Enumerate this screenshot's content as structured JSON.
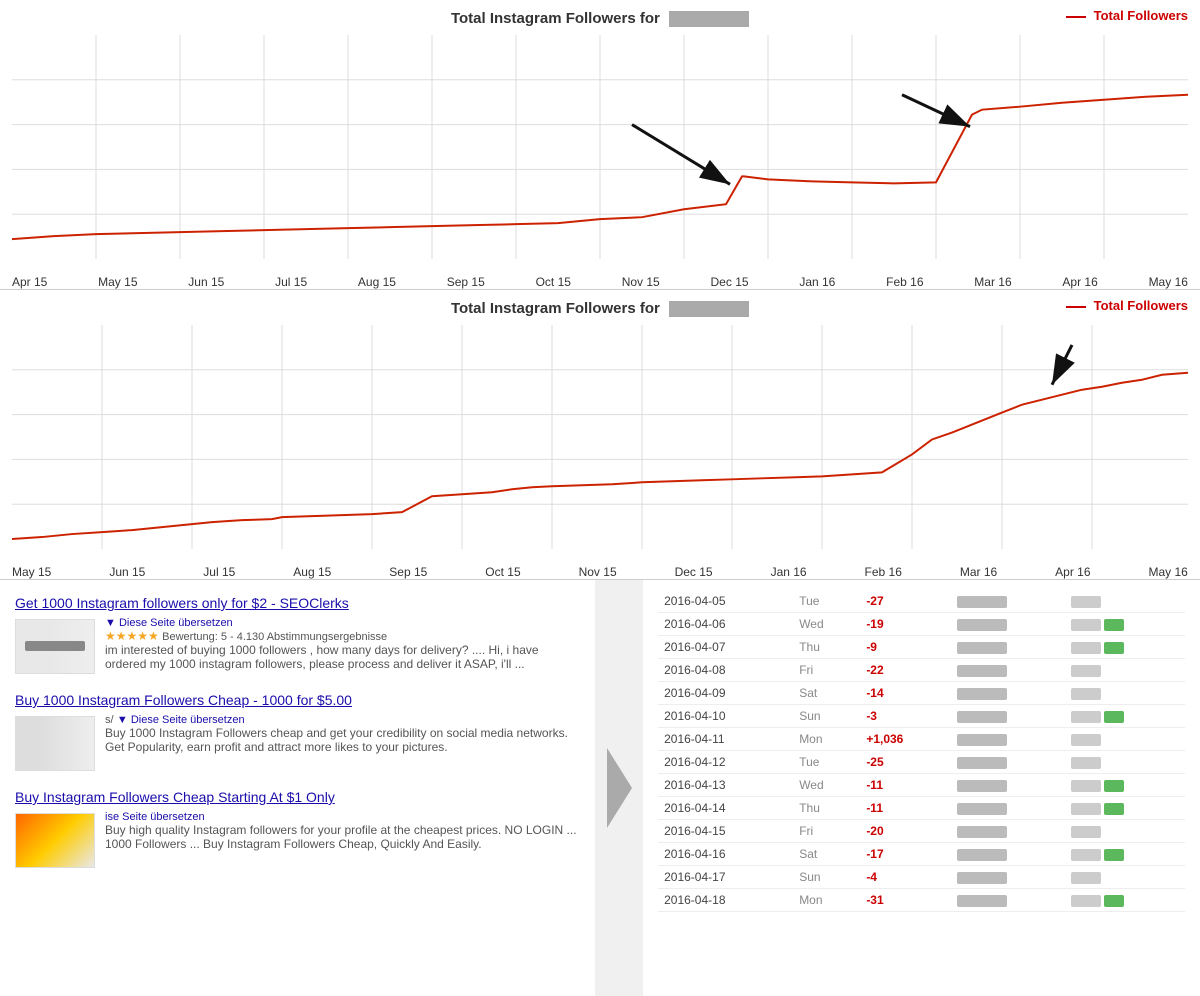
{
  "chart1": {
    "title": "Total Instagram Followers for",
    "legend": "Total Followers",
    "x_labels": [
      "Apr 15",
      "May 15",
      "Jun 15",
      "Jul 15",
      "Aug 15",
      "Sep 15",
      "Oct 15",
      "Nov 15",
      "Dec 15",
      "Jan 16",
      "Feb 16",
      "Mar 16",
      "Apr 16",
      "May 16"
    ]
  },
  "chart2": {
    "title": "Total Instagram Followers for",
    "legend": "Total Followers",
    "x_labels": [
      "May 15",
      "Jun 15",
      "Jul 15",
      "Aug 15",
      "Sep 15",
      "Oct 15",
      "Nov 15",
      "Dec 15",
      "Jan 16",
      "Feb 16",
      "Mar 16",
      "Apr 16",
      "May 16"
    ]
  },
  "search_results": [
    {
      "title": "Get 1000 Instagram followers only for $2 - SEOClerks",
      "translate": "Diese Seite übersetzen",
      "rating": "Bewertung: 5 - 4.130 Abstimmungsergebnisse",
      "snippet": "im interested of buying 1000 followers , how many days for delivery? .... Hi, i have ordered my 1000 instagram followers, please process and deliver it ASAP, i'll ..."
    },
    {
      "title": "Buy 1000 Instagram Followers Cheap - 1000 for $5.00",
      "translate": "Diese Seite übersetzen",
      "snippet": "Buy 1000 Instagram Followers cheap and get your credibility on social media networks. Get Popularity, earn profit and attract more likes to your pictures."
    },
    {
      "title": "Buy Instagram Followers Cheap Starting At $1 Only",
      "translate": "Diese Seite übersetzen",
      "snippet": "Buy high quality Instagram followers for your profile at the cheapest prices. NO LOGIN ... 1000 Followers ... Buy Instagram Followers Cheap, Quickly And Easily."
    }
  ],
  "table": {
    "rows": [
      {
        "date": "2016-04-05",
        "day": "Tue",
        "change": "-27"
      },
      {
        "date": "2016-04-06",
        "day": "Wed",
        "change": "-19"
      },
      {
        "date": "2016-04-07",
        "day": "Thu",
        "change": "-9"
      },
      {
        "date": "2016-04-08",
        "day": "Fri",
        "change": "-22"
      },
      {
        "date": "2016-04-09",
        "day": "Sat",
        "change": "-14"
      },
      {
        "date": "2016-04-10",
        "day": "Sun",
        "change": "-3"
      },
      {
        "date": "2016-04-11",
        "day": "Mon",
        "change": "+1,036"
      },
      {
        "date": "2016-04-12",
        "day": "Tue",
        "change": "-25"
      },
      {
        "date": "2016-04-13",
        "day": "Wed",
        "change": "-11"
      },
      {
        "date": "2016-04-14",
        "day": "Thu",
        "change": "-11"
      },
      {
        "date": "2016-04-15",
        "day": "Fri",
        "change": "-20"
      },
      {
        "date": "2016-04-16",
        "day": "Sat",
        "change": "-17"
      },
      {
        "date": "2016-04-17",
        "day": "Sun",
        "change": "-4"
      },
      {
        "date": "2016-04-18",
        "day": "Mon",
        "change": "-31"
      }
    ]
  }
}
